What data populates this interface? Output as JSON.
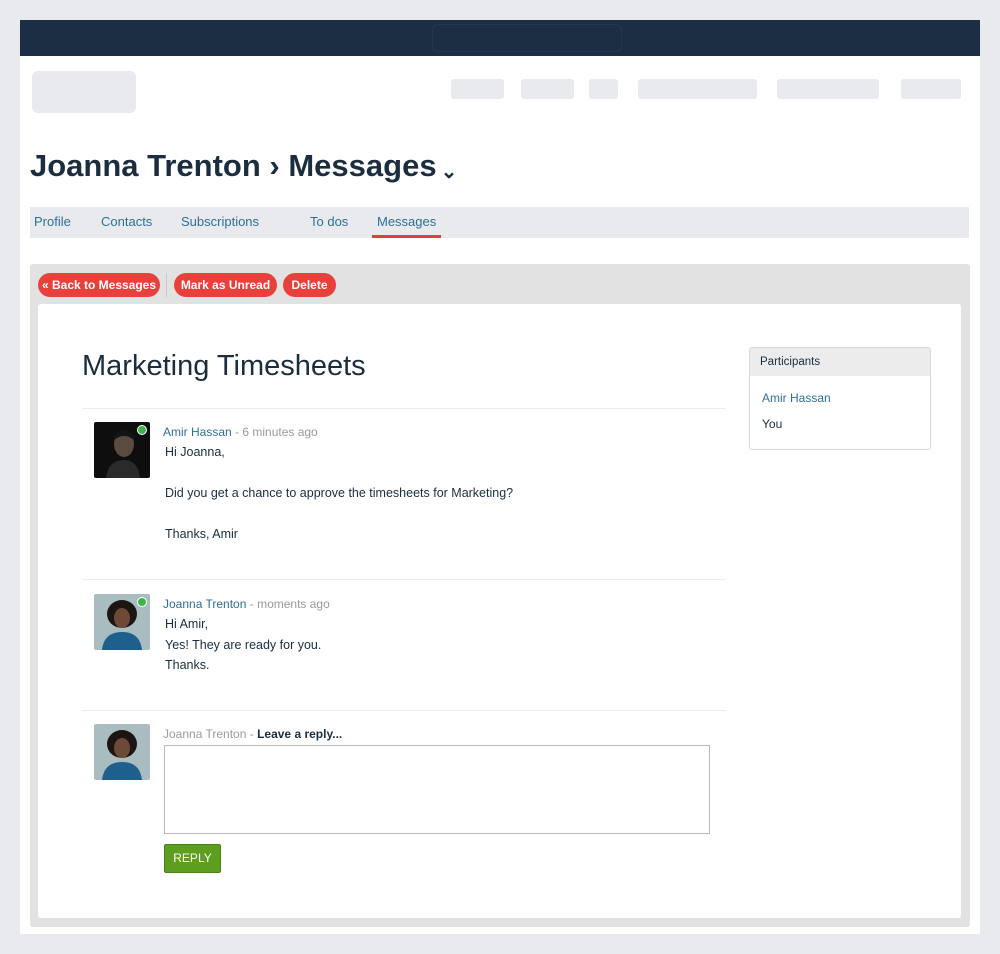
{
  "header": {
    "title": "Joanna Trenton › Messages",
    "caret": "⌄"
  },
  "tabs": [
    {
      "label": "Profile"
    },
    {
      "label": "Contacts"
    },
    {
      "label": "Subscriptions"
    },
    {
      "label": "To dos"
    },
    {
      "label": "Messages",
      "active": true
    }
  ],
  "toolbar": {
    "back_label": "« Back to Messages",
    "unread_label": "Mark as Unread",
    "delete_label": "Delete"
  },
  "thread": {
    "subject": "Marketing Timesheets",
    "messages": [
      {
        "author": "Amir Hassan",
        "time": " - 6 minutes ago",
        "online": true,
        "lines": [
          "Hi Joanna,",
          "Did you get a chance to approve the timesheets for Marketing?",
          "Thanks, Amir"
        ]
      },
      {
        "author": "Joanna Trenton",
        "time": " - moments ago",
        "online": true,
        "lines": [
          "Hi Amir,",
          "Yes! They are ready for you.",
          "Thanks."
        ]
      }
    ],
    "reply": {
      "author": "Joanna Trenton",
      "separator": " - ",
      "prompt": "Leave a reply...",
      "value": "",
      "button_label": "REPLY"
    }
  },
  "participants": {
    "header": "Participants",
    "items": [
      "Amir Hassan",
      "You"
    ]
  },
  "colors": {
    "accent_red": "#e8403a",
    "navy": "#1b2e44",
    "link_blue": "#2e6f97",
    "reply_green": "#5e9e1e",
    "online_green": "#3db54a"
  }
}
